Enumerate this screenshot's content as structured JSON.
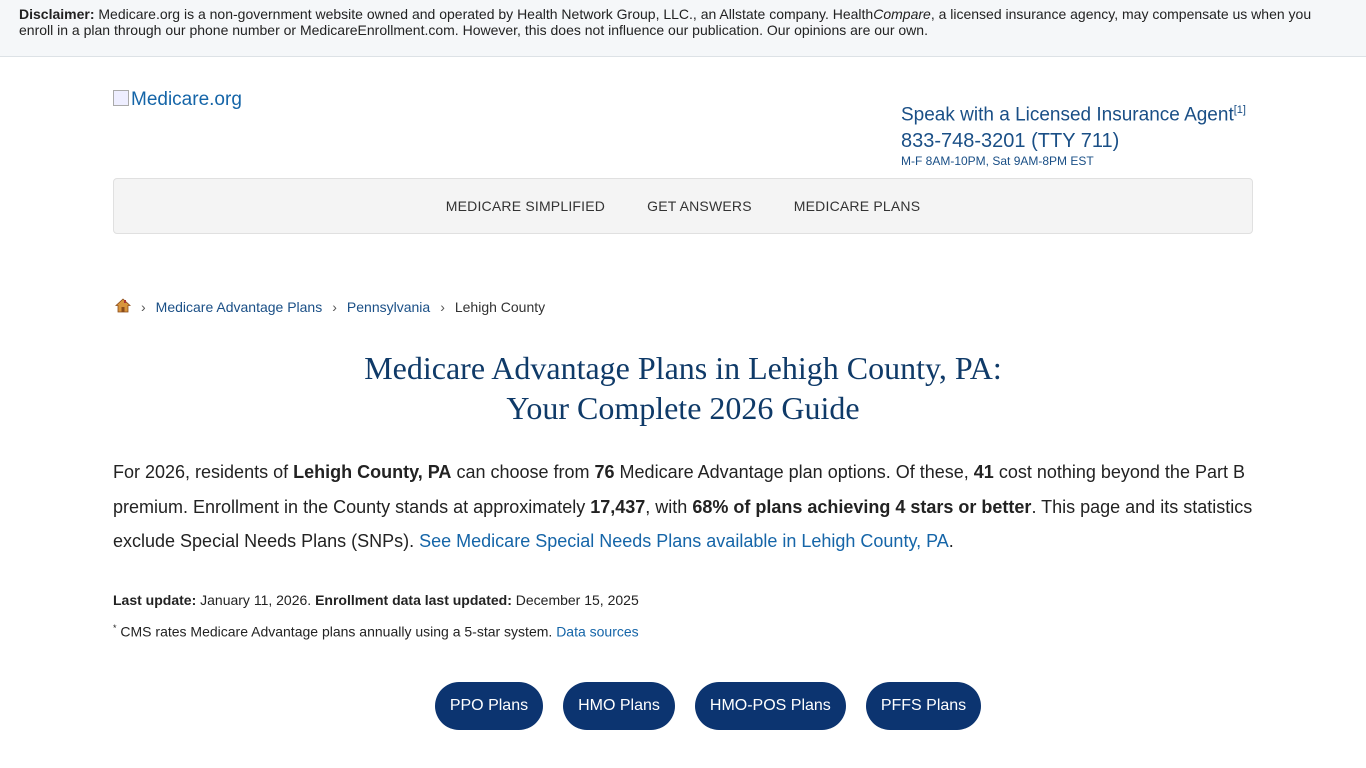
{
  "disclaimer": {
    "label": "Disclaimer:",
    "text_1": " Medicare.org is a non-government website owned and operated by Health Network Group, LLC., an Allstate company. Health",
    "text_italic": "Compare",
    "text_2": ", a licensed insurance agency, may compensate us when you enroll in a plan through our phone number or MedicareEnrollment.com. However, this does not influence our publication. Our opinions are our own."
  },
  "header": {
    "logo_alt": "Medicare.org",
    "agent_title": "Speak with a Licensed Insurance Agent",
    "agent_footnote": "[1]",
    "phone": "833-748-3201 (TTY 711)",
    "hours": "M-F 8AM-10PM, Sat 9AM-8PM EST"
  },
  "nav": {
    "items": [
      "MEDICARE SIMPLIFIED",
      "GET ANSWERS",
      "MEDICARE PLANS"
    ]
  },
  "breadcrumb": {
    "home_icon": "home-icon",
    "sep": "›",
    "items": [
      "Medicare Advantage Plans",
      "Pennsylvania",
      "Lehigh County"
    ]
  },
  "page": {
    "title_line1": "Medicare Advantage Plans in Lehigh County, PA:",
    "title_line2": "Your Complete 2026 Guide"
  },
  "intro": {
    "t1": "For 2026, residents of ",
    "b1": "Lehigh County, PA",
    "t2": " can choose from ",
    "b2": "76",
    "t3": " Medicare Advantage plan options. Of these, ",
    "b3": "41",
    "t4": " cost nothing beyond the Part B premium. Enrollment in the County stands at approximately ",
    "b4": "17,437",
    "t5": ", with ",
    "b5": "68% of plans achieving 4 stars or better",
    "t6": ". This page and its statistics exclude Special Needs Plans (SNPs). ",
    "link": "See Medicare Special Needs Plans available in Lehigh County, PA",
    "t7": "."
  },
  "meta": {
    "last_update_label": "Last update:",
    "last_update": " January 11, 2026. ",
    "enroll_label": "Enrollment data last updated:",
    "enroll_date": " December 15, 2025"
  },
  "footnote": {
    "mark": "*",
    "text": " CMS rates Medicare Advantage plans annually using a 5-star system. ",
    "link": "Data sources"
  },
  "plan_buttons": [
    "PPO Plans",
    "HMO Plans",
    "HMO-POS Plans",
    "PFFS Plans"
  ],
  "colors": {
    "navy": "#0c3470",
    "link": "#1565a8",
    "title": "#0f3a68"
  }
}
